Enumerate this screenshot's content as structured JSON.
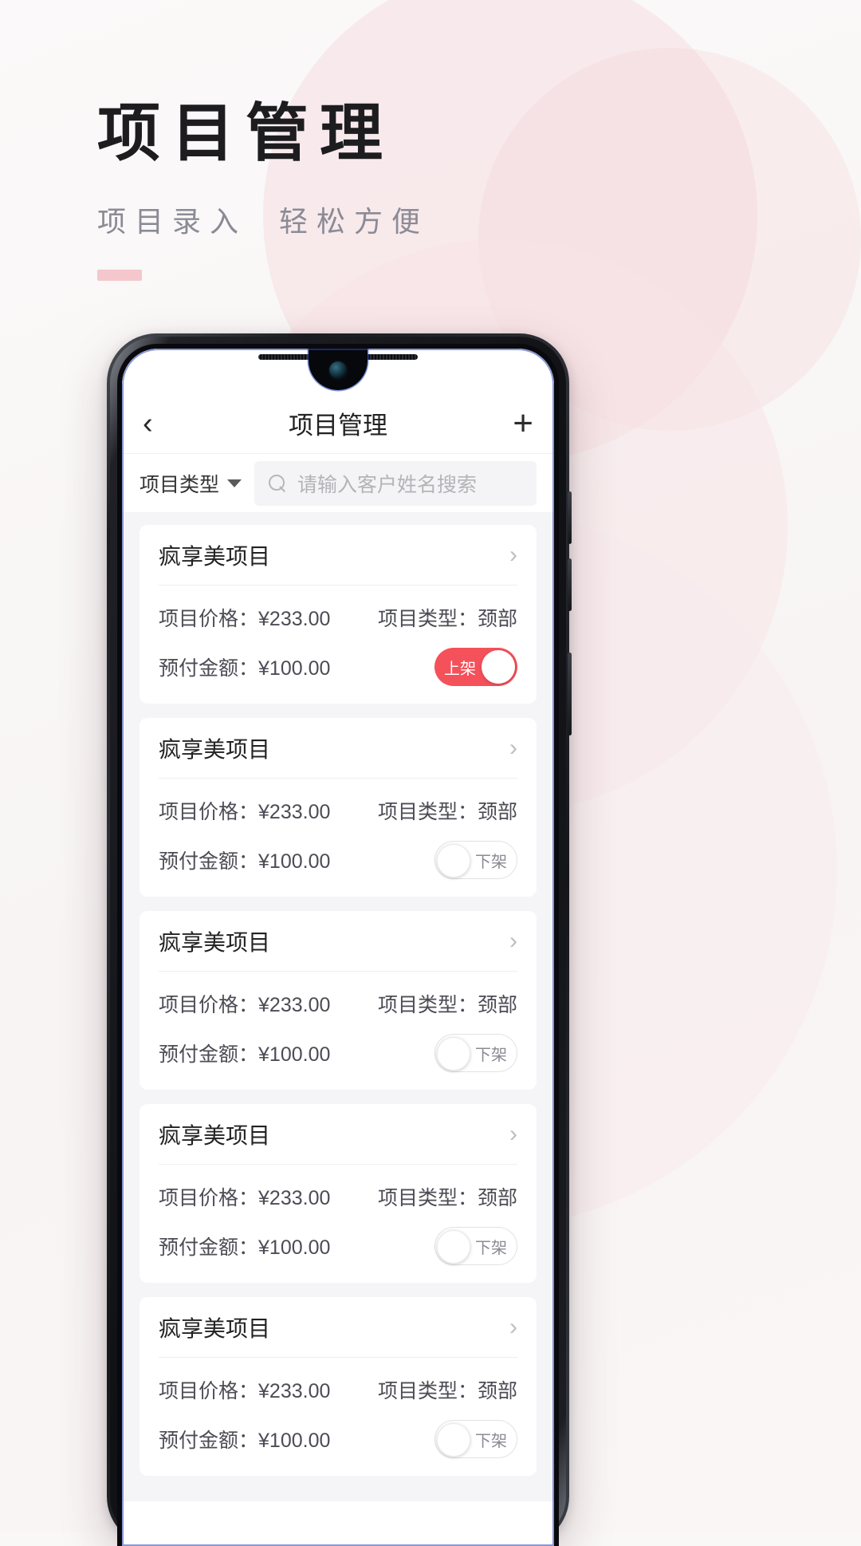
{
  "poster": {
    "title": "项目管理",
    "subtitle": "项目录入  轻松方便",
    "accent_color": "#f4c7cd"
  },
  "phone": {
    "navbar": {
      "back_icon": "chevron-left-icon",
      "title": "项目管理",
      "add_icon": "plus-icon",
      "add_label": "+",
      "back_label": "‹"
    },
    "filter": {
      "type_label": "项目类型",
      "caret_icon": "chevron-down-icon",
      "search_icon": "search-icon",
      "search_placeholder": "请输入客户姓名搜索",
      "search_value": ""
    },
    "labels": {
      "price_key": "项目价格：",
      "deposit_key": "预付金额：",
      "type_key": "项目类型：",
      "chevron_icon": "chevron-right-icon",
      "chevron_glyph": "›"
    },
    "cards": [
      {
        "title": "疯享美项目",
        "price": "¥233.00",
        "deposit": "¥100.00",
        "type": "颈部",
        "toggle_label": "上架",
        "toggle_on": true
      },
      {
        "title": "疯享美项目",
        "price": "¥233.00",
        "deposit": "¥100.00",
        "type": "颈部",
        "toggle_label": "下架",
        "toggle_on": false
      },
      {
        "title": "疯享美项目",
        "price": "¥233.00",
        "deposit": "¥100.00",
        "type": "颈部",
        "toggle_label": "下架",
        "toggle_on": false
      },
      {
        "title": "疯享美项目",
        "price": "¥233.00",
        "deposit": "¥100.00",
        "type": "颈部",
        "toggle_label": "下架",
        "toggle_on": false
      },
      {
        "title": "疯享美项目",
        "price": "¥233.00",
        "deposit": "¥100.00",
        "type": "颈部",
        "toggle_label": "下架",
        "toggle_on": false
      }
    ]
  },
  "colors": {
    "toggle_on": "#f4515a",
    "background": "#faf7f7",
    "list_bg": "#f5f5f7"
  }
}
